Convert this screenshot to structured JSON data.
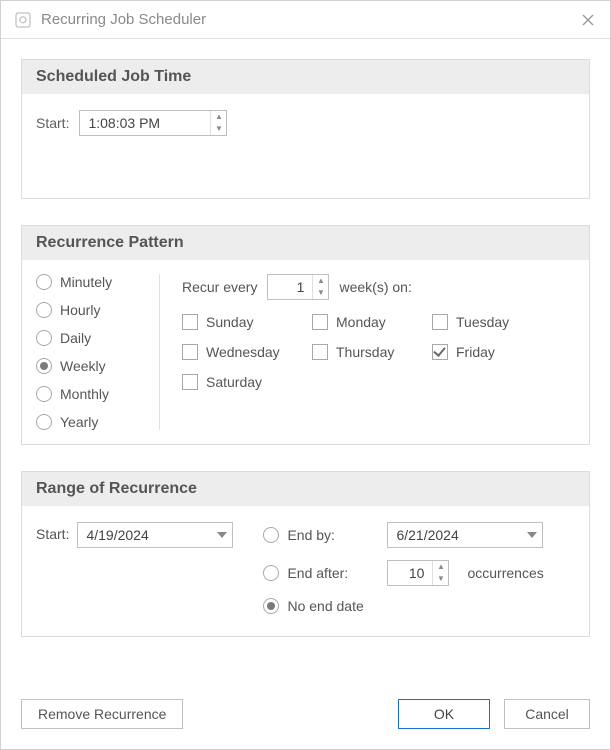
{
  "window": {
    "title": "Recurring Job Scheduler",
    "title_icon": "recurrence-icon",
    "close_icon": "close-icon"
  },
  "scheduled_time": {
    "header": "Scheduled Job Time",
    "start_label": "Start:",
    "start_value": "1:08:03 PM"
  },
  "recurrence_pattern": {
    "header": "Recurrence Pattern",
    "options": {
      "minutely": "Minutely",
      "hourly": "Hourly",
      "daily": "Daily",
      "weekly": "Weekly",
      "monthly": "Monthly",
      "yearly": "Yearly"
    },
    "selected": "weekly",
    "recur_every_label_prefix": "Recur every",
    "recur_every_value": "1",
    "recur_every_label_suffix": "week(s) on:",
    "days": {
      "sunday": {
        "label": "Sunday",
        "checked": false
      },
      "monday": {
        "label": "Monday",
        "checked": false
      },
      "tuesday": {
        "label": "Tuesday",
        "checked": false
      },
      "wednesday": {
        "label": "Wednesday",
        "checked": false
      },
      "thursday": {
        "label": "Thursday",
        "checked": false
      },
      "friday": {
        "label": "Friday",
        "checked": true
      },
      "saturday": {
        "label": "Saturday",
        "checked": false
      }
    }
  },
  "range": {
    "header": "Range of Recurrence",
    "start_label": "Start:",
    "start_date": "4/19/2024",
    "end_by_label": "End by:",
    "end_by_date": "6/21/2024",
    "end_after_label": "End after:",
    "end_after_value": "10",
    "occurrences_label": "occurrences",
    "no_end_label": "No end date",
    "selected": "no_end"
  },
  "footer": {
    "remove_label": "Remove Recurrence",
    "ok_label": "OK",
    "cancel_label": "Cancel"
  }
}
